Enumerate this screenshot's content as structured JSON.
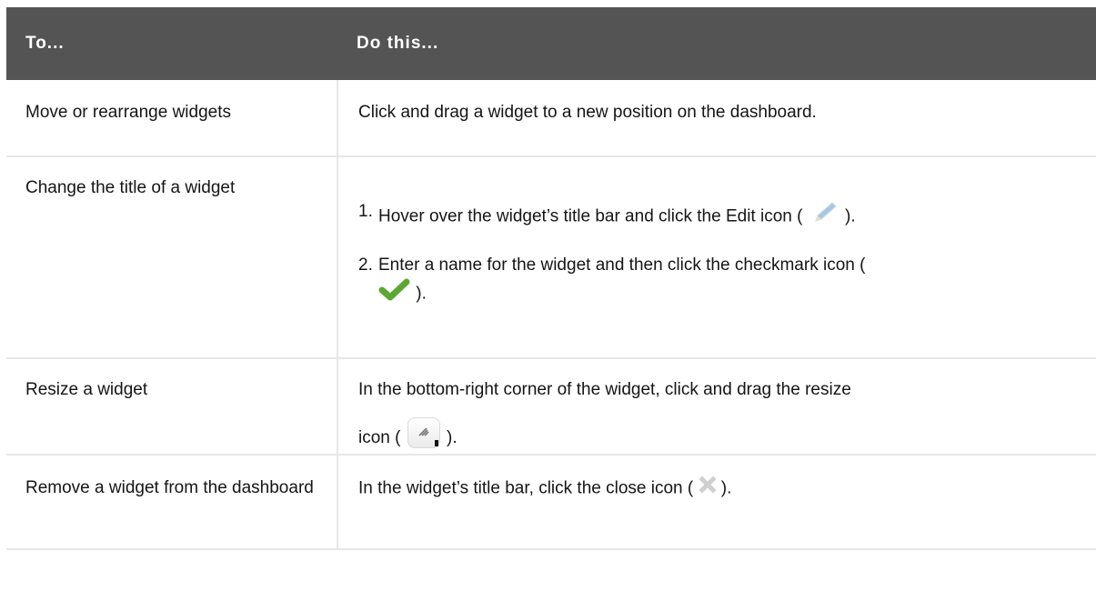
{
  "table": {
    "headers": [
      "To...",
      "Do this..."
    ],
    "rows": [
      {
        "task": "Move or rearrange widgets",
        "action": "Click and drag a widget to a new position on the dashboard."
      },
      {
        "task": "Change the title of a widget",
        "steps": [
          {
            "num": "1.",
            "before": "Hover over the widget’s title bar and click the Edit icon (",
            "icon": "pencil-icon",
            "after": ")."
          },
          {
            "num": "2.",
            "before": "Enter a name for the widget and then click the checkmark icon (",
            "icon": "checkmark-icon",
            "after": ")."
          }
        ]
      },
      {
        "task": "Resize a widget",
        "action_line1": "In the bottom-right corner of the widget, click and drag the resize",
        "action_line2_before": "icon (",
        "icon": "resize-icon",
        "action_line2_after": ")."
      },
      {
        "task": "Remove a widget from the dashboard",
        "action_before": "In the widget’s title bar, click the close icon (",
        "icon": "close-icon",
        "action_after": ")."
      }
    ]
  },
  "colors": {
    "header_bg": "#545454",
    "header_text": "#ffffff",
    "check_green": "#5aa832",
    "pencil_blue": "#a7c6e6"
  }
}
